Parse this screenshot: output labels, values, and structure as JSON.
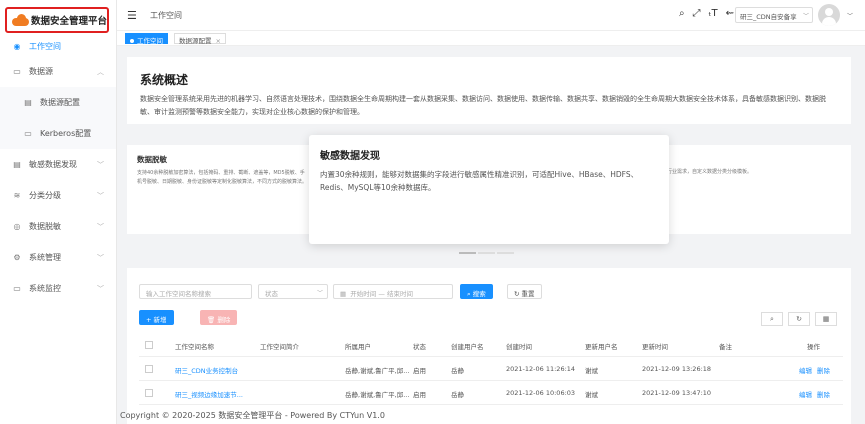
{
  "app": {
    "title": "数据安全管理平台"
  },
  "sidebar": {
    "items": [
      {
        "label": "工作空间",
        "icon": "workspace-icon"
      },
      {
        "label": "数据源",
        "icon": "datasource-icon"
      },
      {
        "label": "数据源配置",
        "icon": "config-icon"
      },
      {
        "label": "Kerberos配置",
        "icon": "monitor-icon"
      },
      {
        "label": "敏感数据发现",
        "icon": "discovery-icon"
      },
      {
        "label": "分类分级",
        "icon": "classify-icon"
      },
      {
        "label": "数据脱敏",
        "icon": "eye-icon"
      },
      {
        "label": "系统管理",
        "icon": "gear-icon"
      },
      {
        "label": "系统监控",
        "icon": "monitor-icon"
      }
    ]
  },
  "header": {
    "breadcrumb": "工作空间",
    "user_select": "研三_CDN自安备享",
    "icons": [
      "search-icon",
      "fullscreen-icon",
      "font-size-icon",
      "translate-icon"
    ]
  },
  "tags": {
    "active": "工作空间",
    "second": "数据源配置",
    "close": "×"
  },
  "overview": {
    "title": "系统概述",
    "text": "数据安全管理系统采用先进的机器学习、自然语言处理技术，围绕数据全生命周期构建一套从数据采集、数据访问、数据使用、数据传输、数据共享、数据销毁的全生命周期大数据安全技术体系，具备敏感数据识别、数据脱敏、审计监测预警等数据安全能力，实现对企业核心数据的保护和管理。"
  },
  "features": {
    "left_title": "数据脱敏",
    "left_text": "支持40余种脱敏加密算法，包括掩码、重排、截断、遮盖等，MD5脱敏、手机号脱敏、日期脱敏、身份证脱敏等定制化脱敏算法，不同方式的脱敏算法。",
    "right_text": "行业需求，自定义数据分类分级模板。",
    "popup_title": "敏感数据发现",
    "popup_text": "内置30余种规则，能够对数据集的字段进行敏感属性精准识别，可适配Hive、HBase、HDFS、Redis、MySQL等10余种数据库。"
  },
  "table": {
    "search_placeholder": "输入工作空间名称搜索",
    "status_placeholder": "状态",
    "start_placeholder": "开始时间",
    "date_sep": "—",
    "end_placeholder": "结束时间",
    "search_btn": "搜索",
    "reset_btn": "重置",
    "add_btn": "+ 新增",
    "delete_btn": "删除",
    "columns": [
      "工作空间名称",
      "工作空间简介",
      "所属用户",
      "状态",
      "创建用户名",
      "创建时间",
      "更新用户名",
      "更新时间",
      "备注",
      "操作"
    ],
    "rows": [
      {
        "name": "研三_CDN业务控制台",
        "desc": "",
        "users": "岳静,谢斌,鲁广平,邱...",
        "status": "启用",
        "creator": "岳静",
        "created": "2021-12-06 11:26:14",
        "updater": "谢斌",
        "updated": "2021-12-09 13:26:18",
        "note": "",
        "edit": "编辑",
        "del": "删除"
      },
      {
        "name": "研三_视频边缘加速节...",
        "desc": "",
        "users": "岳静,谢斌,鲁广平,邱...",
        "status": "启用",
        "creator": "岳静",
        "created": "2021-12-06 10:06:03",
        "updater": "谢斌",
        "updated": "2021-12-09 13:47:10",
        "note": "",
        "edit": "编辑",
        "del": "删除"
      }
    ]
  },
  "footer": "Copyright © 2020-2025 数据安全管理平台 - Powered By CTYun V1.0"
}
